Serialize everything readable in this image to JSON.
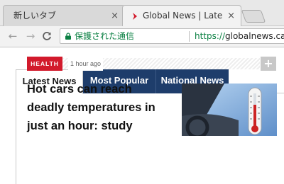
{
  "browser": {
    "tabs": [
      {
        "title": "新しいタブ",
        "close": "×"
      },
      {
        "title": "Global News | Latest &",
        "close": "×"
      }
    ],
    "toolbar": {
      "back": "←",
      "forward": "→",
      "reload": "C",
      "security_text": "保護された通信",
      "url_scheme": "https://",
      "url_host": "globalnews.ca"
    }
  },
  "page": {
    "tabs": [
      "Latest News",
      "Most Popular",
      "National News"
    ],
    "article": {
      "category": "HEALTH",
      "time": "1 hour ago",
      "expand_label": "+",
      "headline": "Hot cars can reach deadly temperatures in just an hour: study"
    }
  },
  "colors": {
    "nav_tab_bg": "#1e3d6b",
    "badge_bg": "#d21a2c",
    "secure_green": "#0b8043"
  }
}
